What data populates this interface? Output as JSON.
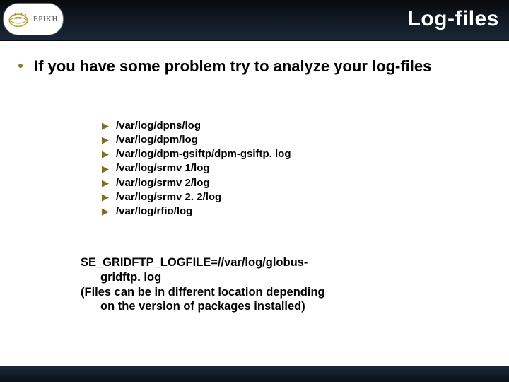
{
  "header": {
    "title": "Log-files",
    "logo_text": "EPIKH"
  },
  "lead": {
    "text": "If you have some problem try to  analyze your log-files"
  },
  "paths": [
    "/var/log/dpns/log",
    "/var/log/dpm/log",
    "/var/log/dpm-gsiftp/dpm-gsiftp. log",
    "/var/log/srmv 1/log",
    "/var/log/srmv 2/log",
    "/var/log/srmv 2. 2/log",
    "/var/log/rfio/log"
  ],
  "note": {
    "line1a": "SE_GRIDFTP_LOGFILE=//var/log/globus-",
    "line1b": "gridftp. log",
    "line2a": "(Files can be in different location depending",
    "line2b": "on the version of packages installed)"
  }
}
